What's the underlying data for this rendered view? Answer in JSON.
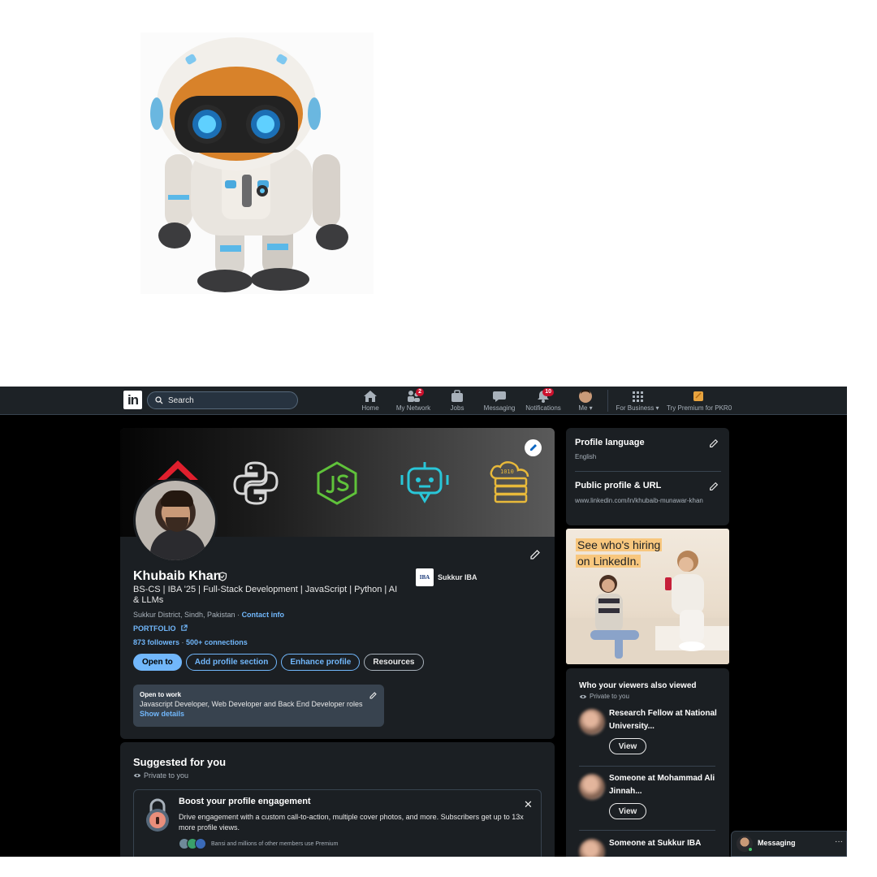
{
  "nav": {
    "search_placeholder": "Search",
    "items": [
      {
        "label": "Home",
        "icon": "home-icon"
      },
      {
        "label": "My Network",
        "icon": "network-icon",
        "badge": "2"
      },
      {
        "label": "Jobs",
        "icon": "jobs-icon"
      },
      {
        "label": "Messaging",
        "icon": "messaging-icon"
      },
      {
        "label": "Notifications",
        "icon": "bell-icon",
        "badge": "10"
      },
      {
        "label": "Me",
        "icon": "me-avatar"
      },
      {
        "label": "For Business",
        "icon": "grid-icon"
      },
      {
        "label": "Try Premium for PKR0",
        "icon": "premium-icon"
      }
    ]
  },
  "profile": {
    "name": "Khubaib Khan",
    "headline": "BS-CS | IBA '25 | Full-Stack Development | JavaScript | Python | AI & LLMs",
    "school_logo_text": "IBA",
    "school": "Sukkur IBA",
    "location": "Sukkur District, Sindh, Pakistan",
    "location_sep": " · ",
    "contact": "Contact info",
    "portfolio": "PORTFOLIO",
    "followers": "873 followers",
    "followers_sep": " · ",
    "connections": "500+ connections",
    "buttons": {
      "open_to": "Open to",
      "add_section": "Add profile section",
      "enhance": "Enhance profile",
      "resources": "Resources"
    },
    "open_to_work": {
      "title": "Open to work",
      "roles": "Javascript Developer, Web Developer and Back End Developer roles",
      "show": "Show details"
    }
  },
  "suggested": {
    "title": "Suggested for you",
    "private": "Private to you",
    "boost_title": "Boost your profile engagement",
    "boost_desc": "Drive engagement with a custom call-to-action, multiple cover photos, and more. Subscribers get up to 13x more profile views.",
    "members_text": "Bansi and millions of other members use Premium"
  },
  "sidebar": {
    "language_title": "Profile language",
    "language_value": "English",
    "url_title": "Public profile & URL",
    "url_value": "www.linkedin.com/in/khubaib-munawar-khan"
  },
  "ad": {
    "line1": "See who's hiring",
    "line2": "on LinkedIn."
  },
  "viewers": {
    "title": "Who your viewers also viewed",
    "private": "Private to you",
    "view_label": "View",
    "items": [
      {
        "name": "Research Fellow at National University..."
      },
      {
        "name": "Someone at Mohammad Ali Jinnah..."
      },
      {
        "name": "Someone at Sukkur IBA"
      }
    ]
  },
  "messaging": {
    "label": "Messaging",
    "more": "···"
  },
  "colors": {
    "accent": "#71b7fb",
    "background": "#000000",
    "card": "#1b1f23",
    "badge": "#cb112d"
  }
}
